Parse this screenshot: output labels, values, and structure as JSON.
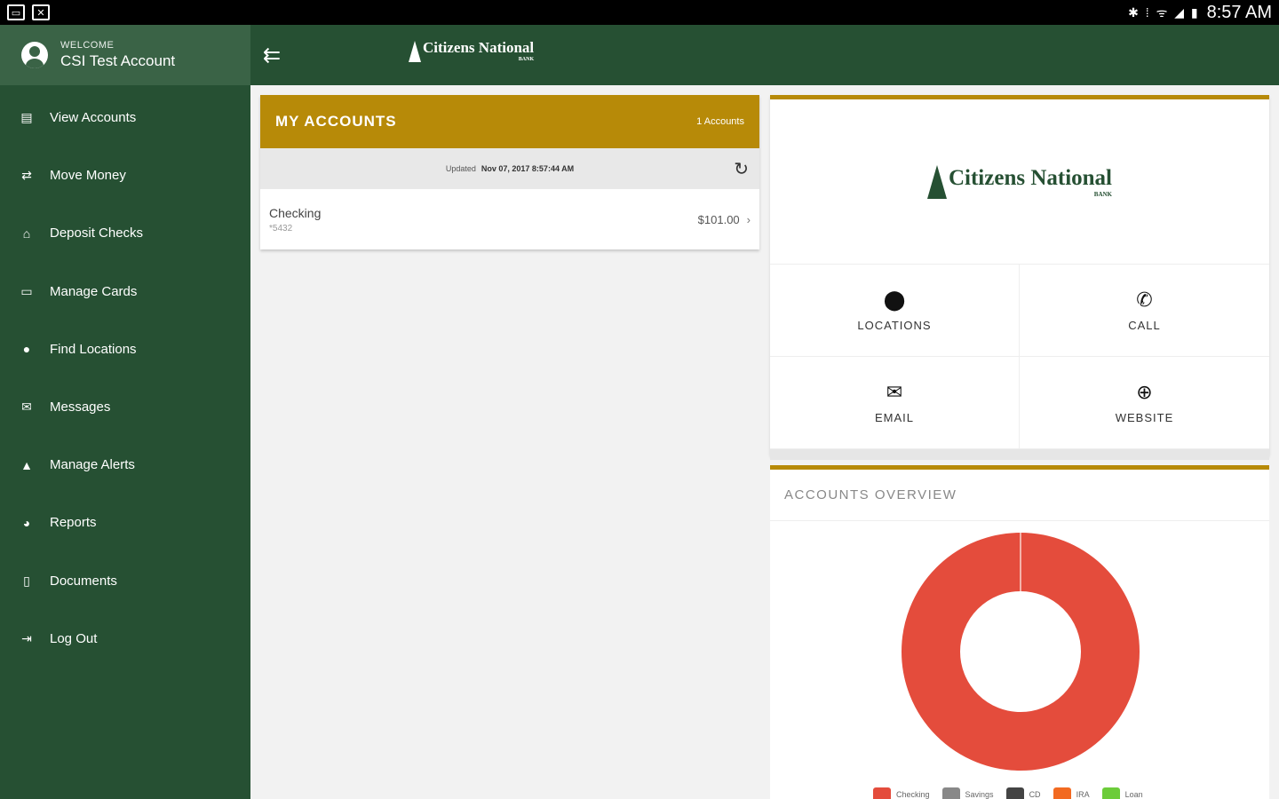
{
  "status_bar": {
    "time": "8:57 AM",
    "icons": "✱ ⁞ ᯤ ◢ ▮"
  },
  "sidebar": {
    "welcome_label": "WELCOME",
    "user_name": "CSI Test Account",
    "items": [
      {
        "label": "View Accounts",
        "icon": "accounts-icon"
      },
      {
        "label": "Move Money",
        "icon": "transfer-icon"
      },
      {
        "label": "Deposit Checks",
        "icon": "bank-icon"
      },
      {
        "label": "Manage Cards",
        "icon": "card-icon"
      },
      {
        "label": "Find Locations",
        "icon": "location-pin-icon"
      },
      {
        "label": "Messages",
        "icon": "envelope-icon"
      },
      {
        "label": "Manage Alerts",
        "icon": "bell-icon"
      },
      {
        "label": "Reports",
        "icon": "pie-chart-icon"
      },
      {
        "label": "Documents",
        "icon": "document-icon"
      },
      {
        "label": "Log Out",
        "icon": "logout-icon"
      }
    ]
  },
  "brand": {
    "name": "Citizens National",
    "sub": "BANK",
    "green": "#265033",
    "gold": "#b78a08"
  },
  "accounts": {
    "title": "MY ACCOUNTS",
    "count": "1 Accounts",
    "updated_label": "Updated",
    "updated_value": "Nov 07, 2017 8:57:44 AM",
    "rows": [
      {
        "name": "Checking",
        "number": "*5432",
        "balance": "$101.00"
      }
    ]
  },
  "contact": {
    "locations": "LOCATIONS",
    "call": "CALL",
    "email": "EMAIL",
    "website": "WEBSITE"
  },
  "overview": {
    "title": "ACCOUNTS OVERVIEW"
  },
  "chart_data": {
    "type": "pie",
    "categories": [
      "Checking",
      "Savings",
      "CD",
      "IRA",
      "Loan"
    ],
    "values": [
      101.0,
      0,
      0,
      0,
      0
    ],
    "colors": [
      "#e44c3c",
      "#888888",
      "#444444",
      "#f26a21",
      "#6ccc3a"
    ],
    "legend": "bottom"
  }
}
